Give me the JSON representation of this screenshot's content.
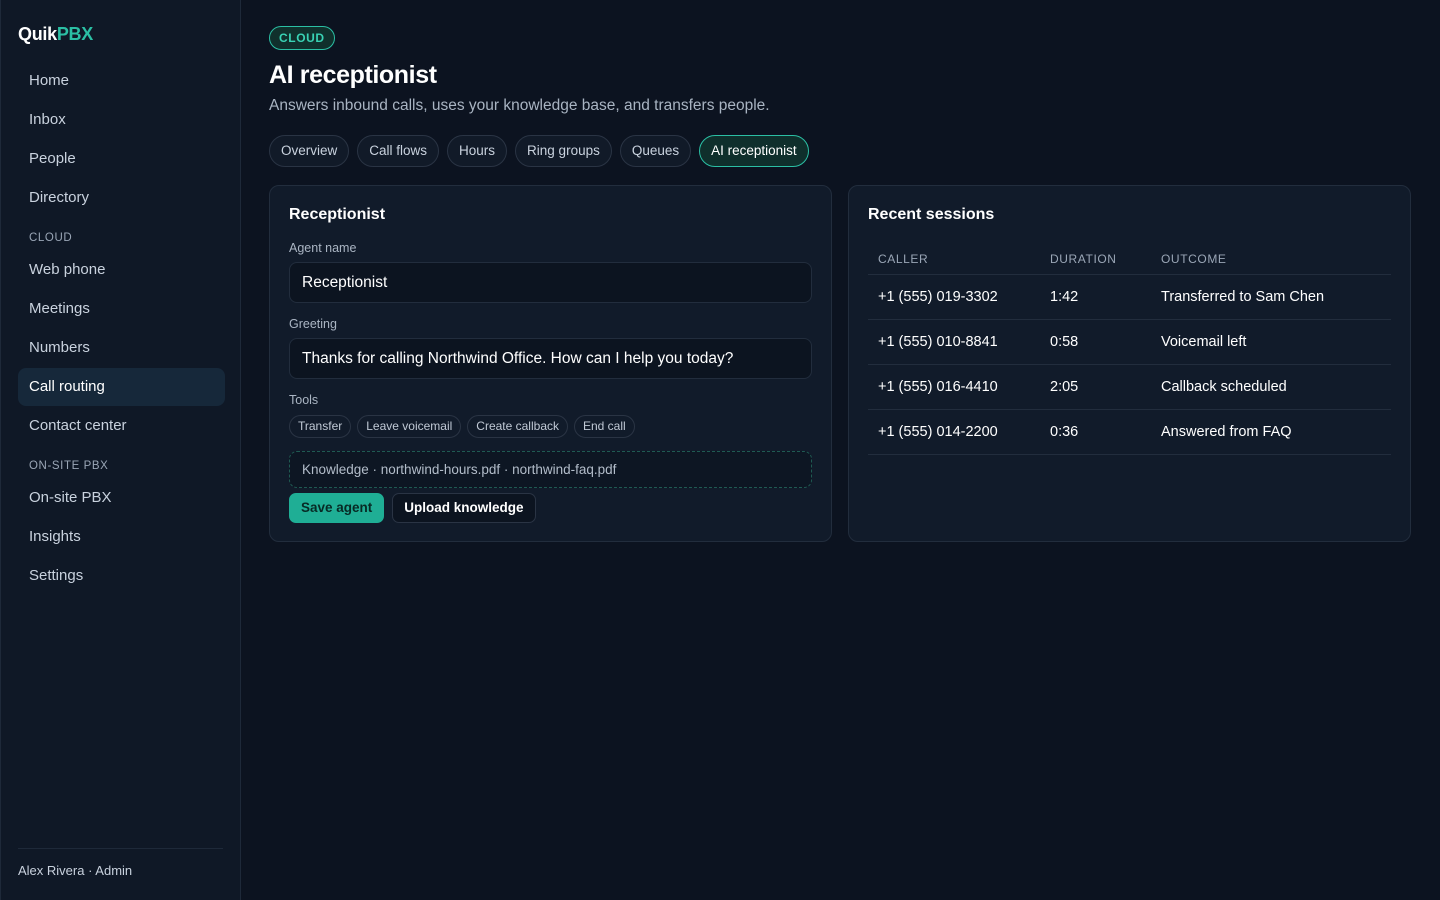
{
  "brand": {
    "part1": "Quik",
    "part2": "PBX"
  },
  "sidebar": {
    "items_top": [
      {
        "label": "Home"
      },
      {
        "label": "Inbox"
      },
      {
        "label": "People"
      },
      {
        "label": "Directory"
      }
    ],
    "section_cloud": "CLOUD",
    "items_cloud": [
      {
        "label": "Web phone"
      },
      {
        "label": "Meetings"
      },
      {
        "label": "Numbers"
      },
      {
        "label": "Call routing"
      },
      {
        "label": "Contact center"
      }
    ],
    "section_onsite": "ON-SITE PBX",
    "items_onsite": [
      {
        "label": "On-site PBX"
      },
      {
        "label": "Insights"
      },
      {
        "label": "Settings"
      }
    ],
    "footer": "Alex Rivera · Admin"
  },
  "header": {
    "badge": "CLOUD",
    "title": "AI receptionist",
    "subtitle": "Answers inbound calls, uses your knowledge base, and transfers people."
  },
  "tabs": [
    {
      "label": "Overview"
    },
    {
      "label": "Call flows"
    },
    {
      "label": "Hours"
    },
    {
      "label": "Ring groups"
    },
    {
      "label": "Queues"
    },
    {
      "label": "AI receptionist"
    }
  ],
  "receptionist": {
    "title": "Receptionist",
    "agent_name_label": "Agent name",
    "agent_name_value": "Receptionist",
    "greeting_label": "Greeting",
    "greeting_value": "Thanks for calling Northwind Office. How can I help you today?",
    "tools_label": "Tools",
    "tools": [
      "Transfer",
      "Leave voicemail",
      "Create callback",
      "End call"
    ],
    "knowledge": "Knowledge · northwind-hours.pdf · northwind-faq.pdf",
    "save_label": "Save agent",
    "upload_label": "Upload knowledge"
  },
  "sessions": {
    "title": "Recent sessions",
    "columns": [
      "CALLER",
      "DURATION",
      "OUTCOME"
    ],
    "rows": [
      {
        "caller": "+1 (555) 019-3302",
        "duration": "1:42",
        "outcome": "Transferred to Sam Chen"
      },
      {
        "caller": "+1 (555) 010-8841",
        "duration": "0:58",
        "outcome": "Voicemail left"
      },
      {
        "caller": "+1 (555) 016-4410",
        "duration": "2:05",
        "outcome": "Callback scheduled"
      },
      {
        "caller": "+1 (555) 014-2200",
        "duration": "0:36",
        "outcome": "Answered from FAQ"
      }
    ]
  },
  "colors": {
    "accent": "#2bbfa4",
    "background": "#0c1320",
    "card": "#111b2a"
  }
}
